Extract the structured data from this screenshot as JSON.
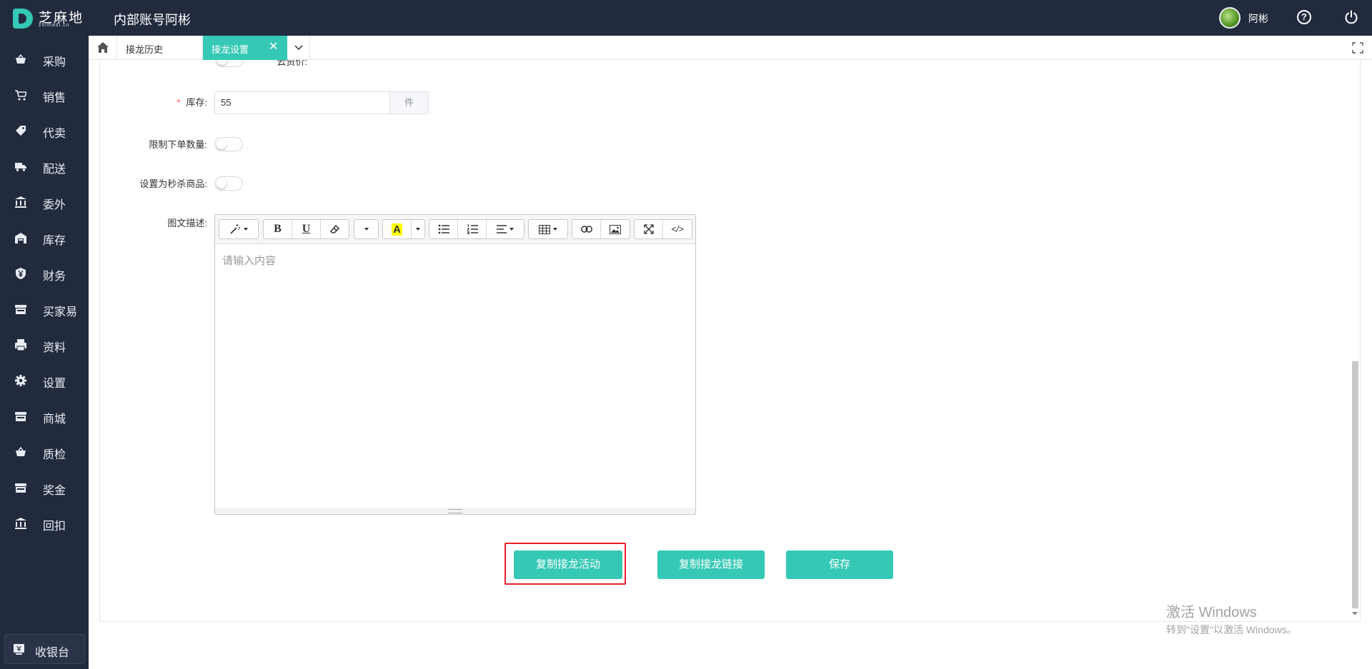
{
  "header": {
    "logo_text": "芝麻地",
    "logo_sub": "zhimadi.cn",
    "account_title": "内部账号阿彬",
    "user_name": "阿彬"
  },
  "sidebar": {
    "items": [
      {
        "label": "采购",
        "icon": "basket-icon"
      },
      {
        "label": "销售",
        "icon": "cart-icon"
      },
      {
        "label": "代卖",
        "icon": "tag-icon"
      },
      {
        "label": "配送",
        "icon": "truck-icon"
      },
      {
        "label": "委外",
        "icon": "bank-icon"
      },
      {
        "label": "库存",
        "icon": "warehouse-icon"
      },
      {
        "label": "财务",
        "icon": "yen-shield-icon"
      },
      {
        "label": "买家易",
        "icon": "store-icon"
      },
      {
        "label": "资料",
        "icon": "printer-icon"
      },
      {
        "label": "设置",
        "icon": "gear-icon"
      },
      {
        "label": "商城",
        "icon": "shop-icon"
      },
      {
        "label": "质检",
        "icon": "basket-icon"
      },
      {
        "label": "奖金",
        "icon": "store-icon"
      },
      {
        "label": "回扣",
        "icon": "bank-icon"
      }
    ],
    "cashier_label": "收银台"
  },
  "tabs": {
    "history_label": "接龙历史",
    "settings_label": "接龙设置",
    "close_glyph": "✕"
  },
  "form": {
    "cut_label": "云资价:",
    "stock_label": "库存:",
    "stock_value": "55",
    "stock_unit": "件",
    "limit_label": "限制下单数量:",
    "seckill_label": "设置为秒杀商品:",
    "desc_label": "图文描述:",
    "editor_placeholder": "请输入内容"
  },
  "editor_toolbar": {
    "bold": "B",
    "underline": "U",
    "highlight": "A",
    "code": "</>"
  },
  "actions": {
    "copy_activity": "复制接龙活动",
    "copy_link": "复制接龙链接",
    "save": "保存"
  },
  "watermark": {
    "title": "激活 Windows",
    "subtitle": "转到\"设置\"以激活 Windows。"
  },
  "colors": {
    "accent": "#35c9b5",
    "sidebar_bg": "#222b3e",
    "highlight_border": "#e8202a"
  }
}
